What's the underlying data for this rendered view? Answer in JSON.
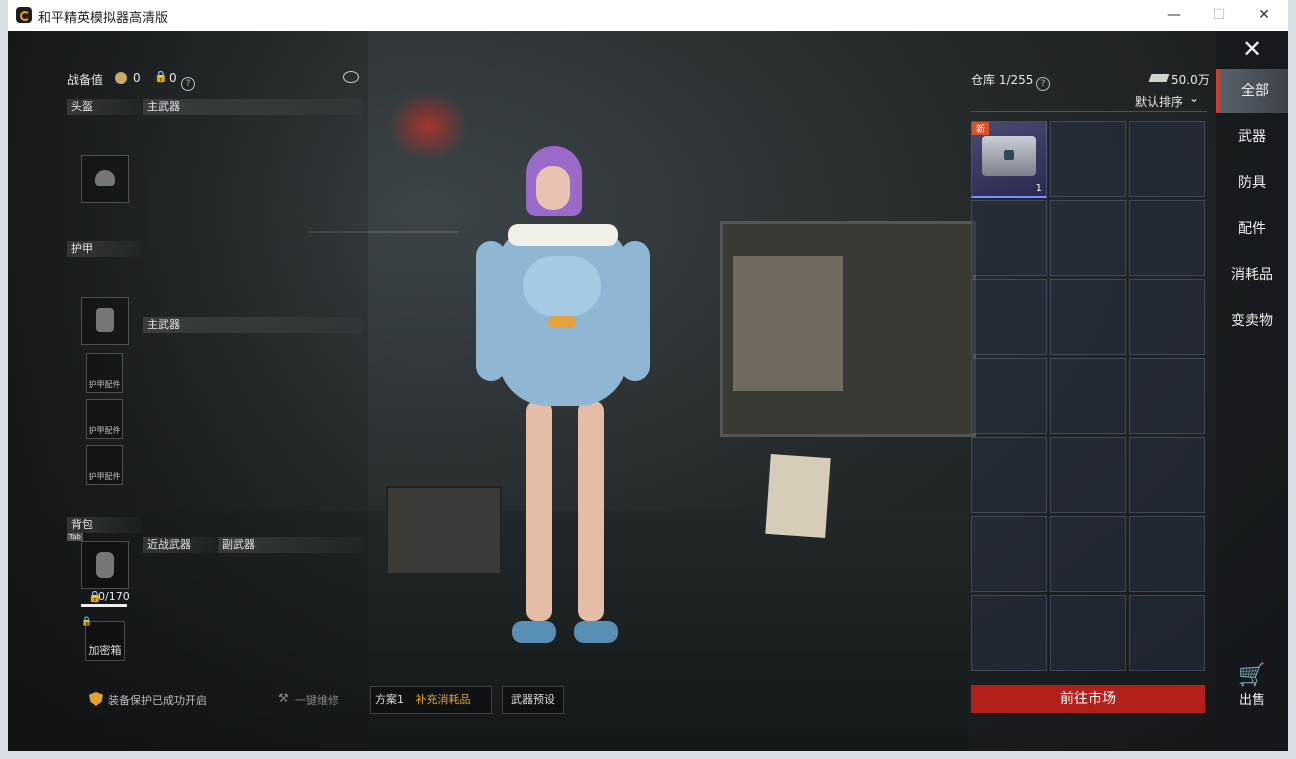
{
  "window": {
    "title": "和平精英模拟器高清版",
    "minimize": "—",
    "maximize": "☐",
    "close": "✕"
  },
  "header": {
    "combat_label": "战备值",
    "combat_value": "0",
    "lock_value": "0"
  },
  "slots": {
    "helmet": "头盔",
    "primary1": "主武器",
    "armor": "护甲",
    "primary2": "主武器",
    "armor_part": "护甲配件",
    "backpack": "背包",
    "backpack_tab": "Tab",
    "capacity": "0/170",
    "melee": "近战武器",
    "secondary": "副武器",
    "safe_box": "加密箱"
  },
  "bottom": {
    "protect": "装备保护已成功开启",
    "repair": "一键维修",
    "plan": "方案1",
    "supply": "补充消耗品",
    "preset": "武器预设"
  },
  "warehouse": {
    "title": "仓库 1/255",
    "money": "50.0万",
    "sort": "默认排序",
    "new_tag": "新",
    "item_qty": "1",
    "go_market": "前往市场"
  },
  "tabs": [
    "全部",
    "武器",
    "防具",
    "配件",
    "消耗品",
    "变卖物"
  ],
  "sell": "出售",
  "colors": {
    "accent_red": "#b3201c",
    "tab_active_border": "#d43a2c"
  }
}
